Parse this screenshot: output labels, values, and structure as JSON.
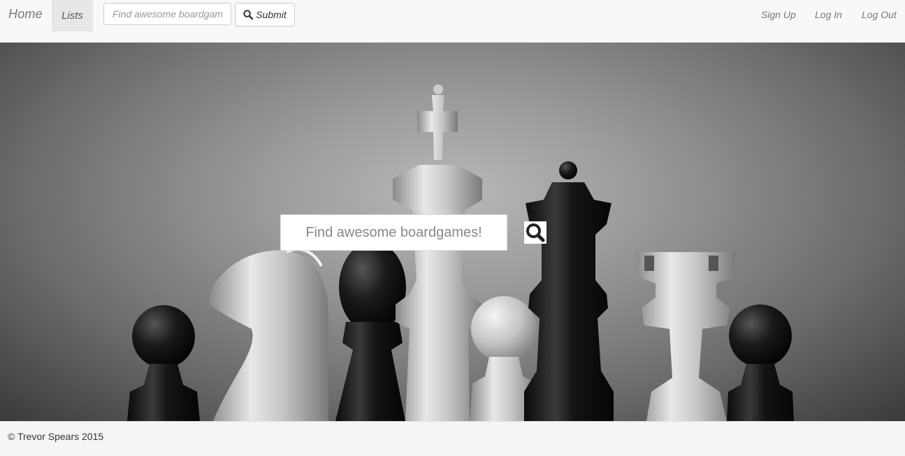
{
  "navbar": {
    "brand": "Home",
    "lists_label": "Lists",
    "search_placeholder": "Find awesome boardgames!",
    "submit_label": "Submit",
    "submit_icon": "search-icon",
    "right_links": {
      "sign_up": "Sign Up",
      "log_in": "Log In",
      "log_out": "Log Out"
    }
  },
  "hero": {
    "search_placeholder": "Find awesome boardgames!",
    "search_icon": "search-icon"
  },
  "footer": {
    "text": "© Trevor Spears 2015"
  },
  "colors": {
    "navbar_bg": "#f8f8f8",
    "active_tab_bg": "#e7e7e7",
    "footer_bg": "#f5f5f5"
  }
}
